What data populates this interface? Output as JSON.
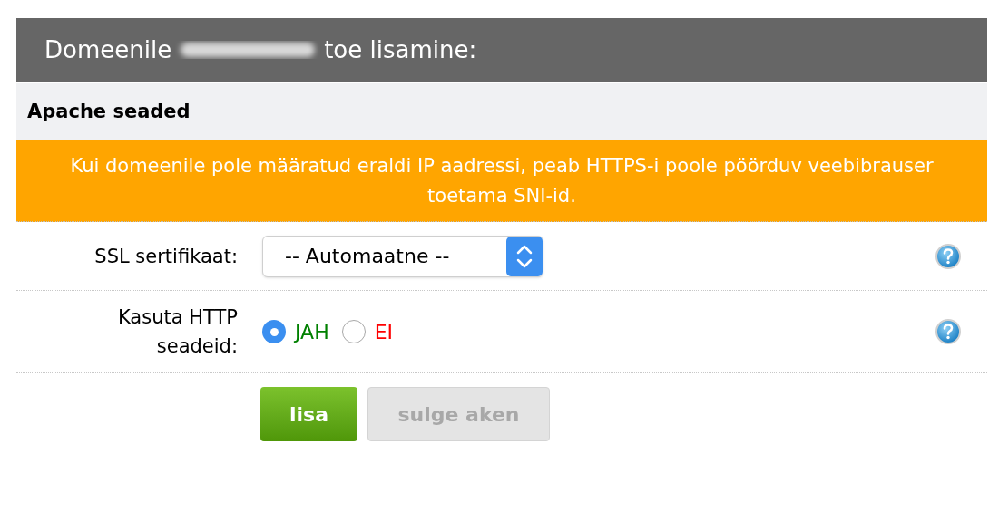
{
  "header": {
    "title_before": "Domeenile",
    "title_after": "toe lisamine:"
  },
  "section": {
    "title": "Apache seaded"
  },
  "notice": {
    "text": "Kui domeenile pole määratud eraldi IP aadressi, peab HTTPS-i poole pöörduv veebibrauser toetama SNI-id."
  },
  "fields": [
    {
      "kind": "select",
      "label": "SSL sertifikaat:",
      "value": "-- Automaatne --"
    },
    {
      "kind": "radio",
      "label": "Kasuta HTTP seadeid:",
      "options": [
        {
          "label": "JAH",
          "selected": true,
          "color": "#008000"
        },
        {
          "label": "EI",
          "selected": false,
          "color": "#ff0000"
        }
      ]
    }
  ],
  "buttons": [
    {
      "label": "lisa",
      "disabled": false
    },
    {
      "label": "sulge aken",
      "disabled": true
    }
  ]
}
